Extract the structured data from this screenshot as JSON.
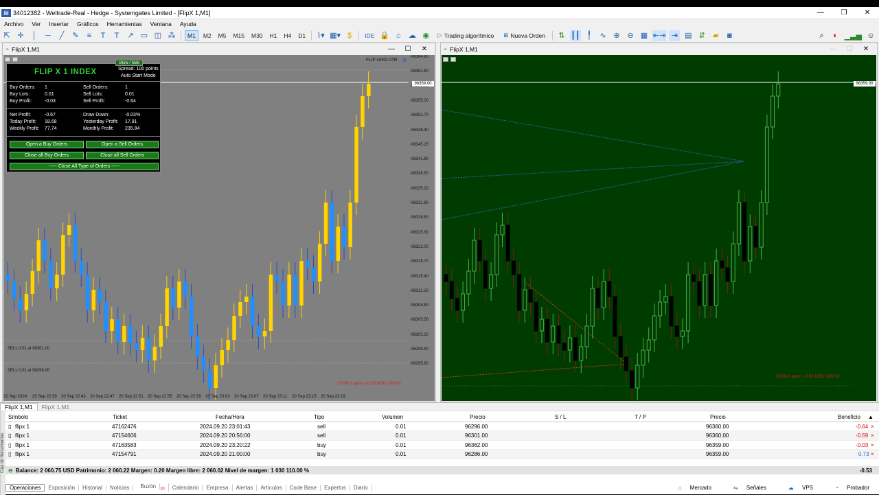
{
  "window": {
    "title": "34012382 - Weltrade-Real - Hedge - Systemgates Limited - [FlipX 1,M1]"
  },
  "menu": [
    "Archivo",
    "Ver",
    "Insertar",
    "Gráficos",
    "Herramientas",
    "Ventana",
    "Ayuda"
  ],
  "toolbar": {
    "timeframes": [
      "M1",
      "M2",
      "M5",
      "M15",
      "M30",
      "H1",
      "H4",
      "D1"
    ],
    "ide": "IDE",
    "algo_trading": "Trading algorítmico",
    "new_order": "Nueva Orden"
  },
  "chart1": {
    "title": "FlipX 1,M1",
    "indicator": "FLIP GRID ATR",
    "panel": {
      "show_hide": "show / hide",
      "title": "FLIP X 1 INDEX",
      "spread": "Spread: 100 points",
      "auto": "Auto Start Mode",
      "buy_orders_label": "Buy Orders:",
      "buy_orders": "1",
      "buy_lots_label": "Buy Lots:",
      "buy_lots": "0.01",
      "buy_profit_label": "Buy Profit:",
      "buy_profit": "-0.03",
      "sell_orders_label": "Sell Orders:",
      "sell_orders": "1",
      "sell_lots_label": "Sell Lots:",
      "sell_lots": "0.01",
      "sell_profit_label": "Sell Profit:",
      "sell_profit": "-0.64",
      "net_profit_label": "Net Profit:",
      "net_profit": "-0.67",
      "today_label": "Today Profit:",
      "today": "18.68",
      "weekly_label": "Weekly Profit:",
      "weekly": "77.74",
      "drawdown_label": "Draw Down:",
      "drawdown": "-0.03%",
      "yesterday_label": "Yesterday Profit:",
      "yesterday": "17.91",
      "monthly_label": "Monthly Profit:",
      "monthly": "235.84",
      "btn_open_buy": "Open a Buy Orders",
      "btn_open_sell": "Open a Sell Orders",
      "btn_close_buy": "Close all Buy Orders",
      "btn_close_sell": "Close all Sell Orders",
      "btn_close_all": "-----  Close All Type of Orders  -----"
    },
    "prices": [
      "96364.90",
      "96361.60",
      "96358.35",
      "96355.00",
      "96351.70",
      "96348.40",
      "96345.15",
      "96341.80",
      "96338.50",
      "96335.20",
      "96331.90",
      "96328.60",
      "96325.30",
      "96322.00",
      "96318.70",
      "96315.40",
      "96312.10",
      "96308.80",
      "96305.50",
      "96302.20",
      "96298.90",
      "96295.60"
    ],
    "current_price": "96359.00",
    "sell_label_1": "SELL 0.01 at 96301.00",
    "sell_label_2": "SELL 0.01 at 96296.00",
    "pips": "-5300.0 pips | -0.53 USD | 00:02",
    "times": [
      "20 Sep 2024",
      "20 Sep 22:39",
      "20 Sep 22:43",
      "20 Sep 22:47",
      "20 Sep 22:51",
      "20 Sep 22:55",
      "20 Sep 22:59",
      "20 Sep 23:03",
      "20 Sep 23:07",
      "20 Sep 23:11",
      "20 Sep 23:15",
      "20 Sep 23:19"
    ]
  },
  "chart2": {
    "title": "FlipX 1,M1",
    "current_price": "96359.00",
    "pips": "-5300.0 pips | -0.53 USD | 00:02"
  },
  "bottom": {
    "tabs": [
      "FlipX 1,M1",
      "FlipX 1,M1"
    ],
    "headers": {
      "symbol": "Símbolo",
      "ticket": "Ticket",
      "time": "Fecha/Hora",
      "type": "Tipo",
      "volume": "Volumen",
      "price": "Precio",
      "sl": "S / L",
      "tp": "T / P",
      "price2": "Precio",
      "profit": "Beneficio"
    },
    "rows": [
      {
        "symbol": "flipx 1",
        "ticket": "47162476",
        "time": "2024.09.20 23:01:43",
        "type": "sell",
        "volume": "0.01",
        "price": "96296.00",
        "price2": "96360.00",
        "profit": "-0.64"
      },
      {
        "symbol": "flipx 1",
        "ticket": "47154606",
        "time": "2024.09.20 20:56:00",
        "type": "sell",
        "volume": "0.01",
        "price": "96301.00",
        "price2": "96360.00",
        "profit": "-0.59"
      },
      {
        "symbol": "flipx 1",
        "ticket": "47163583",
        "time": "2024.09.20 23:20:22",
        "type": "buy",
        "volume": "0.01",
        "price": "96362.00",
        "price2": "96359.00",
        "profit": "-0.03"
      },
      {
        "symbol": "flipx 1",
        "ticket": "47154791",
        "time": "2024.09.20 21:00:00",
        "type": "buy",
        "volume": "0.01",
        "price": "96286.00",
        "price2": "96359.00",
        "profit": "0.73"
      }
    ],
    "balance": "Balance: 2 060.75 USD  Patrimonio: 2 060.22  Margen: 0.20  Margen libre: 2 060.02  Nivel de margen: 1 030 110.00 %",
    "total": "-0.53",
    "toolbox": "Caja de Herramientas",
    "tabs2": [
      "Operaciones",
      "Exposición",
      "Historial",
      "Noticias",
      "Buzón",
      "Calendario",
      "Empresa",
      "Alertas",
      "Artículos",
      "Code Base",
      "Expertos",
      "Diario"
    ],
    "mailbox_count": "10",
    "right": [
      "Mercado",
      "Señales",
      "VPS",
      "Probador"
    ]
  },
  "colors": {
    "bull": "#ffd400",
    "bear": "#1e90ff",
    "chart1_bg": "#808080",
    "chart2_bg": "#003c00"
  }
}
